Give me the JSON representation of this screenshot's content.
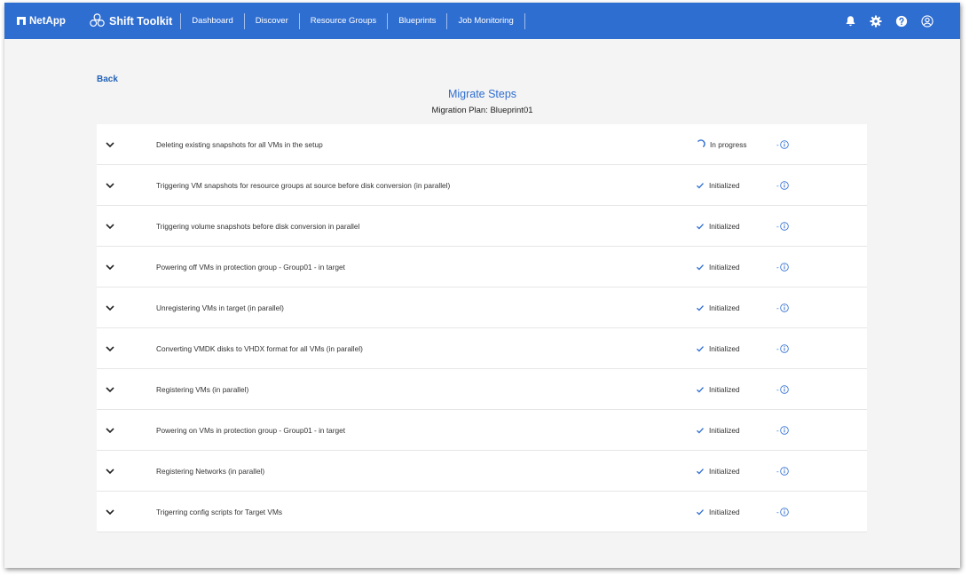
{
  "brand": {
    "logo_text": "NetApp",
    "product_name": "Shift Toolkit"
  },
  "nav": {
    "items": [
      "Dashboard",
      "Discover",
      "Resource Groups",
      "Blueprints",
      "Job Monitoring"
    ]
  },
  "header_icons": [
    "bell-icon",
    "gear-icon",
    "help-icon",
    "user-icon"
  ],
  "page": {
    "back_label": "Back",
    "title": "Migrate Steps",
    "subtitle": "Migration Plan: Blueprint01"
  },
  "steps": [
    {
      "label": "Deleting existing snapshots for all VMs in the setup",
      "status": "In progress",
      "info": "-"
    },
    {
      "label": "Triggering VM snapshots for resource groups at source before disk conversion (in parallel)",
      "status": "Initialized",
      "info": "-"
    },
    {
      "label": "Triggering volume snapshots before disk conversion in parallel",
      "status": "Initialized",
      "info": "-"
    },
    {
      "label": "Powering off VMs in protection group - Group01 - in target",
      "status": "Initialized",
      "info": "-"
    },
    {
      "label": "Unregistering VMs in target (in parallel)",
      "status": "Initialized",
      "info": "-"
    },
    {
      "label": "Converting VMDK disks to VHDX format for all VMs (in parallel)",
      "status": "Initialized",
      "info": "-"
    },
    {
      "label": "Registering VMs (in parallel)",
      "status": "Initialized",
      "info": "-"
    },
    {
      "label": "Powering on VMs in protection group - Group01 - in target",
      "status": "Initialized",
      "info": "-"
    },
    {
      "label": "Registering Networks (in parallel)",
      "status": "Initialized",
      "info": "-"
    },
    {
      "label": "Trigerring config scripts for Target VMs",
      "status": "Initialized",
      "info": "-"
    }
  ],
  "colors": {
    "topbar": "#2f6ed1",
    "accent": "#2f6ed1",
    "link": "#2262b6",
    "background": "#f4f4f4"
  }
}
